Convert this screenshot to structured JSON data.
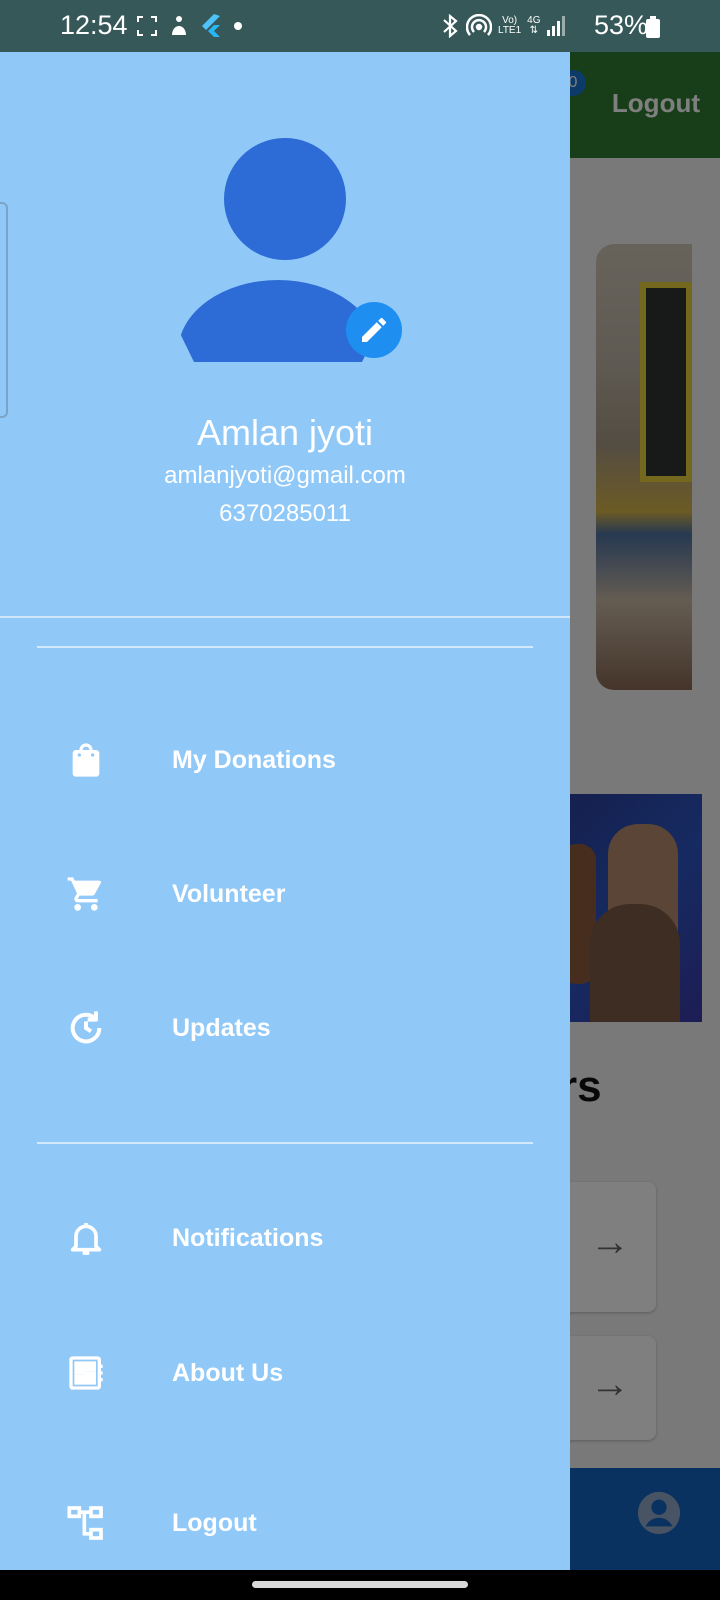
{
  "status_bar": {
    "time": "12:54",
    "battery": "53%",
    "network_top": "Vo)",
    "network_bottom": "LTE1",
    "network_type": "4G",
    "left_icons": [
      "screenshot-icon",
      "fitness-icon",
      "flutter-icon",
      "dot-icon"
    ],
    "right_icons": [
      "bluetooth-icon",
      "hotspot-icon",
      "volte-icon",
      "data-arrows-icon",
      "signal-icon",
      "battery-icon"
    ]
  },
  "background_app": {
    "logout_label": "Logout",
    "section_heading_fragment": "rs",
    "header_color": "#2e7d32",
    "bottom_nav_color": "#1565c0"
  },
  "drawer": {
    "background": "#90c8f8",
    "profile": {
      "name": "Amlan jyoti",
      "email": "amlanjyoti@gmail.com",
      "phone": "6370285011",
      "avatar_color": "#2d6bd6",
      "edit_icon": "pencil-icon"
    },
    "menu": {
      "donations": {
        "label": "My Donations",
        "icon": "shopping-bag-icon"
      },
      "volunteer": {
        "label": "Volunteer",
        "icon": "cart-icon"
      },
      "updates": {
        "label": "Updates",
        "icon": "history-icon"
      },
      "notifications": {
        "label": "Notifications",
        "icon": "bell-icon"
      },
      "about": {
        "label": "About Us",
        "icon": "dashboard-icon"
      },
      "logout": {
        "label": "Logout",
        "icon": "account-tree-icon"
      }
    }
  }
}
